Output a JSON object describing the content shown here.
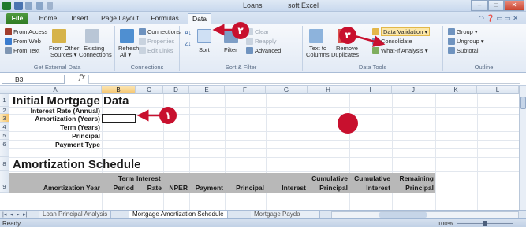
{
  "window": {
    "title_left": "Loans",
    "title_right": "soft Excel",
    "min": "–",
    "max": "□",
    "close": "✕"
  },
  "ribbon_tabs": [
    "File",
    "Home",
    "Insert",
    "Page Layout",
    "Formulas",
    "Data"
  ],
  "ribbon": {
    "get_external": {
      "items": [
        "From Access",
        "From Web",
        "From Text"
      ],
      "from_other": [
        "From Other",
        "Sources ▾"
      ],
      "existing": [
        "Existing",
        "Connections"
      ],
      "label": "Get External Data"
    },
    "connections": {
      "refresh": [
        "Refresh",
        "All ▾"
      ],
      "items": [
        "Connections",
        "Properties",
        "Edit Links"
      ],
      "label": "Connections"
    },
    "sort_filter": {
      "sort": "Sort",
      "filter": "Filter",
      "items": [
        "Clear",
        "Reapply",
        "Advanced"
      ],
      "label": "Sort & Filter"
    },
    "data_tools": {
      "text_to_columns": [
        "Text to",
        "Columns"
      ],
      "remove_dupes": [
        "Remove",
        "Duplicates"
      ],
      "items": [
        "Data Validation ▾",
        "Consolidate",
        "What-If Analysis ▾"
      ],
      "label": "Data Tools"
    },
    "outline": {
      "items": [
        "Group ▾",
        "Ungroup ▾",
        "Subtotal"
      ],
      "label": "Outline"
    }
  },
  "formula_bar": {
    "name_box": "B3",
    "fx": "fx",
    "value": ""
  },
  "columns": [
    "A",
    "B",
    "C",
    "D",
    "E",
    "F",
    "G",
    "H",
    "I",
    "J",
    "K",
    "L"
  ],
  "rows": [
    "1",
    "2",
    "3",
    "4",
    "5",
    "6",
    "7",
    "8",
    "9"
  ],
  "cells": {
    "title": "Initial Mortgage Data",
    "labels": [
      "Interest Rate (Annual)",
      "Amortization (Years)",
      "Term (Years)",
      "Principal",
      "Payment Type"
    ],
    "schedule_title": "Amortization Schedule",
    "schedule_headers": [
      [
        "",
        "Amortization Year"
      ],
      [
        "Term",
        "Period"
      ],
      [
        "Interest",
        "Rate"
      ],
      [
        "",
        "NPER"
      ],
      [
        "",
        "Payment"
      ],
      [
        "",
        "Principal"
      ],
      [
        "",
        "Interest"
      ],
      [
        "Cumulative",
        "Principal"
      ],
      [
        "Cumulative",
        "Interest"
      ],
      [
        "Remaining",
        "Principal"
      ]
    ]
  },
  "sheet_tabs": [
    "Loan Principal Analysis",
    "Mortgage Amortization Schedule",
    "Mortgage Payda"
  ],
  "status": {
    "ready": "Ready",
    "zoom": "100%",
    "zoom_level": 100
  },
  "callouts": [
    "١",
    "٢",
    "٣"
  ],
  "colors": {
    "callout_red": "#c8102e",
    "file_tab_green": "#2f7a23",
    "schedule_header_gray": "#b8b8b8"
  }
}
